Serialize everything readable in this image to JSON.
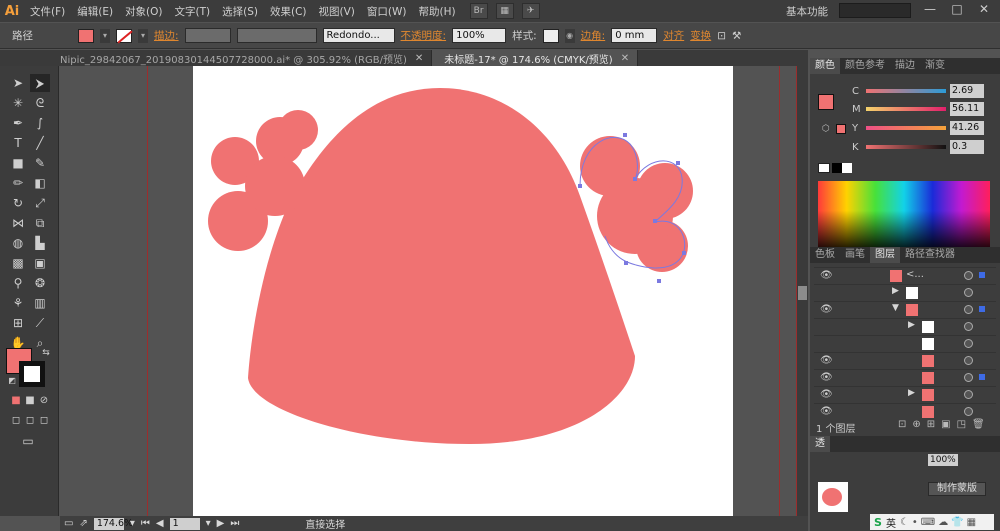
{
  "app": {
    "logo": "Ai",
    "workspace": "基本功能"
  },
  "menu": [
    "文件(F)",
    "编辑(E)",
    "对象(O)",
    "文字(T)",
    "选择(S)",
    "效果(C)",
    "视图(V)",
    "窗口(W)",
    "帮助(H)"
  ],
  "window_controls": {
    "minimize": "—",
    "maximize": "□",
    "close": "✕"
  },
  "controlbar": {
    "selection": "路径",
    "stroke_label": "描边:",
    "brush": "Redondo...",
    "opacity_label": "不透明度:",
    "opacity_value": "100%",
    "style_label": "样式:",
    "corner_label": "边角:",
    "corner_value": "0 mm",
    "align_label": "对齐",
    "transform_label": "变换"
  },
  "tabs": [
    {
      "label": "Nipic_29842067_20190830144507728000.ai* @ 305.92% (RGB/预览)",
      "close": "✕"
    },
    {
      "label": "未标题-17* @ 174.6% (CMYK/预览)",
      "close": "✕"
    }
  ],
  "status": {
    "zoom": "174.6%",
    "page": "1",
    "tool": "直接选择"
  },
  "color_panel": {
    "tabs": [
      "颜色",
      "颜色参考",
      "描边",
      "渐变"
    ],
    "channels": [
      {
        "letter": "C",
        "value": "2.69",
        "from": "#ffffff",
        "to": "#00a0e0"
      },
      {
        "letter": "M",
        "value": "56.11",
        "from": "#ffffff",
        "to": "#e0117f"
      },
      {
        "letter": "Y",
        "value": "41.26",
        "from": "#ffffff",
        "to": "#ffd400"
      },
      {
        "letter": "K",
        "value": "0.3",
        "from": "#ffffff",
        "to": "#000000"
      }
    ]
  },
  "layers_panel": {
    "tabs": [
      "色板",
      "画笔",
      "图层",
      "路径查找器"
    ],
    "top_layer_name": "<...",
    "count_label": "1 个图层"
  },
  "bottom_panel": {
    "tab": "透",
    "opacity_value": "100%",
    "make_mask": "制作蒙版"
  },
  "ime": {
    "label": "英"
  },
  "colors": {
    "fill": "#f07272",
    "accent": "#e0872f",
    "selection": "#7b79e0"
  }
}
